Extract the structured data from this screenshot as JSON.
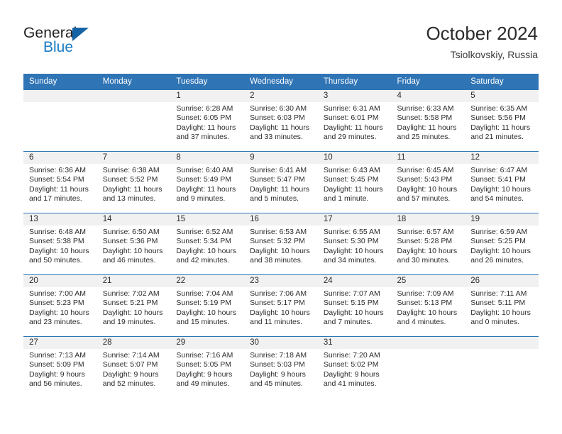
{
  "brand": {
    "name_top": "General",
    "name_bottom": "Blue",
    "triangle_color": "#1464a5",
    "blue_color": "#1a7bc4"
  },
  "header": {
    "title": "October 2024",
    "subtitle": "Tsiolkovskiy, Russia"
  },
  "theme": {
    "accent": "#2f74b5",
    "band": "#f1f1f1",
    "text": "#2b2b2b"
  },
  "weekdays": [
    "Sunday",
    "Monday",
    "Tuesday",
    "Wednesday",
    "Thursday",
    "Friday",
    "Saturday"
  ],
  "weeks": [
    [
      {
        "day": "",
        "lines": []
      },
      {
        "day": "",
        "lines": []
      },
      {
        "day": "1",
        "lines": [
          "Sunrise: 6:28 AM",
          "Sunset: 6:05 PM",
          "Daylight: 11 hours",
          "and 37 minutes."
        ]
      },
      {
        "day": "2",
        "lines": [
          "Sunrise: 6:30 AM",
          "Sunset: 6:03 PM",
          "Daylight: 11 hours",
          "and 33 minutes."
        ]
      },
      {
        "day": "3",
        "lines": [
          "Sunrise: 6:31 AM",
          "Sunset: 6:01 PM",
          "Daylight: 11 hours",
          "and 29 minutes."
        ]
      },
      {
        "day": "4",
        "lines": [
          "Sunrise: 6:33 AM",
          "Sunset: 5:58 PM",
          "Daylight: 11 hours",
          "and 25 minutes."
        ]
      },
      {
        "day": "5",
        "lines": [
          "Sunrise: 6:35 AM",
          "Sunset: 5:56 PM",
          "Daylight: 11 hours",
          "and 21 minutes."
        ]
      }
    ],
    [
      {
        "day": "6",
        "lines": [
          "Sunrise: 6:36 AM",
          "Sunset: 5:54 PM",
          "Daylight: 11 hours",
          "and 17 minutes."
        ]
      },
      {
        "day": "7",
        "lines": [
          "Sunrise: 6:38 AM",
          "Sunset: 5:52 PM",
          "Daylight: 11 hours",
          "and 13 minutes."
        ]
      },
      {
        "day": "8",
        "lines": [
          "Sunrise: 6:40 AM",
          "Sunset: 5:49 PM",
          "Daylight: 11 hours",
          "and 9 minutes."
        ]
      },
      {
        "day": "9",
        "lines": [
          "Sunrise: 6:41 AM",
          "Sunset: 5:47 PM",
          "Daylight: 11 hours",
          "and 5 minutes."
        ]
      },
      {
        "day": "10",
        "lines": [
          "Sunrise: 6:43 AM",
          "Sunset: 5:45 PM",
          "Daylight: 11 hours",
          "and 1 minute."
        ]
      },
      {
        "day": "11",
        "lines": [
          "Sunrise: 6:45 AM",
          "Sunset: 5:43 PM",
          "Daylight: 10 hours",
          "and 57 minutes."
        ]
      },
      {
        "day": "12",
        "lines": [
          "Sunrise: 6:47 AM",
          "Sunset: 5:41 PM",
          "Daylight: 10 hours",
          "and 54 minutes."
        ]
      }
    ],
    [
      {
        "day": "13",
        "lines": [
          "Sunrise: 6:48 AM",
          "Sunset: 5:38 PM",
          "Daylight: 10 hours",
          "and 50 minutes."
        ]
      },
      {
        "day": "14",
        "lines": [
          "Sunrise: 6:50 AM",
          "Sunset: 5:36 PM",
          "Daylight: 10 hours",
          "and 46 minutes."
        ]
      },
      {
        "day": "15",
        "lines": [
          "Sunrise: 6:52 AM",
          "Sunset: 5:34 PM",
          "Daylight: 10 hours",
          "and 42 minutes."
        ]
      },
      {
        "day": "16",
        "lines": [
          "Sunrise: 6:53 AM",
          "Sunset: 5:32 PM",
          "Daylight: 10 hours",
          "and 38 minutes."
        ]
      },
      {
        "day": "17",
        "lines": [
          "Sunrise: 6:55 AM",
          "Sunset: 5:30 PM",
          "Daylight: 10 hours",
          "and 34 minutes."
        ]
      },
      {
        "day": "18",
        "lines": [
          "Sunrise: 6:57 AM",
          "Sunset: 5:28 PM",
          "Daylight: 10 hours",
          "and 30 minutes."
        ]
      },
      {
        "day": "19",
        "lines": [
          "Sunrise: 6:59 AM",
          "Sunset: 5:25 PM",
          "Daylight: 10 hours",
          "and 26 minutes."
        ]
      }
    ],
    [
      {
        "day": "20",
        "lines": [
          "Sunrise: 7:00 AM",
          "Sunset: 5:23 PM",
          "Daylight: 10 hours",
          "and 23 minutes."
        ]
      },
      {
        "day": "21",
        "lines": [
          "Sunrise: 7:02 AM",
          "Sunset: 5:21 PM",
          "Daylight: 10 hours",
          "and 19 minutes."
        ]
      },
      {
        "day": "22",
        "lines": [
          "Sunrise: 7:04 AM",
          "Sunset: 5:19 PM",
          "Daylight: 10 hours",
          "and 15 minutes."
        ]
      },
      {
        "day": "23",
        "lines": [
          "Sunrise: 7:06 AM",
          "Sunset: 5:17 PM",
          "Daylight: 10 hours",
          "and 11 minutes."
        ]
      },
      {
        "day": "24",
        "lines": [
          "Sunrise: 7:07 AM",
          "Sunset: 5:15 PM",
          "Daylight: 10 hours",
          "and 7 minutes."
        ]
      },
      {
        "day": "25",
        "lines": [
          "Sunrise: 7:09 AM",
          "Sunset: 5:13 PM",
          "Daylight: 10 hours",
          "and 4 minutes."
        ]
      },
      {
        "day": "26",
        "lines": [
          "Sunrise: 7:11 AM",
          "Sunset: 5:11 PM",
          "Daylight: 10 hours",
          "and 0 minutes."
        ]
      }
    ],
    [
      {
        "day": "27",
        "lines": [
          "Sunrise: 7:13 AM",
          "Sunset: 5:09 PM",
          "Daylight: 9 hours",
          "and 56 minutes."
        ]
      },
      {
        "day": "28",
        "lines": [
          "Sunrise: 7:14 AM",
          "Sunset: 5:07 PM",
          "Daylight: 9 hours",
          "and 52 minutes."
        ]
      },
      {
        "day": "29",
        "lines": [
          "Sunrise: 7:16 AM",
          "Sunset: 5:05 PM",
          "Daylight: 9 hours",
          "and 49 minutes."
        ]
      },
      {
        "day": "30",
        "lines": [
          "Sunrise: 7:18 AM",
          "Sunset: 5:03 PM",
          "Daylight: 9 hours",
          "and 45 minutes."
        ]
      },
      {
        "day": "31",
        "lines": [
          "Sunrise: 7:20 AM",
          "Sunset: 5:02 PM",
          "Daylight: 9 hours",
          "and 41 minutes."
        ]
      },
      {
        "day": "",
        "lines": []
      },
      {
        "day": "",
        "lines": []
      }
    ]
  ]
}
